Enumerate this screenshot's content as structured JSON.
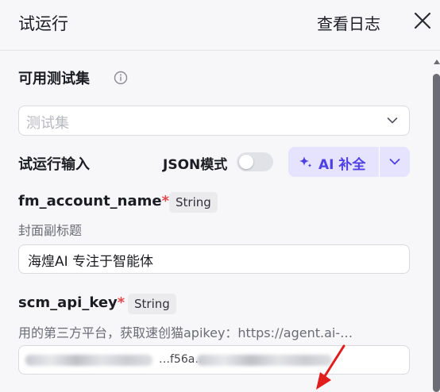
{
  "header": {
    "title": "试运行",
    "view_log": "查看日志"
  },
  "test_set": {
    "label": "可用测试集",
    "placeholder": "测试集"
  },
  "run_input": {
    "label": "试运行输入",
    "json_mode_label": "JSON模式",
    "json_mode_on": false,
    "ai_complete_label": "AI 补全"
  },
  "params": [
    {
      "name": "fm_account_name",
      "required_mark": "*",
      "type": "String",
      "description": "封面副标题",
      "value": "海煌AI 专注于智能体"
    },
    {
      "name": "scm_api_key",
      "required_mark": "*",
      "type": "String",
      "description": "用的第三方平台，获取速创猫apikey：https://agent.ai-…",
      "value": "…f56a…"
    }
  ],
  "colors": {
    "accent": "#4e40e5",
    "accent_bg": "#e5e3fd",
    "required": "#e5484d",
    "annotation_arrow": "#e11d1d"
  }
}
